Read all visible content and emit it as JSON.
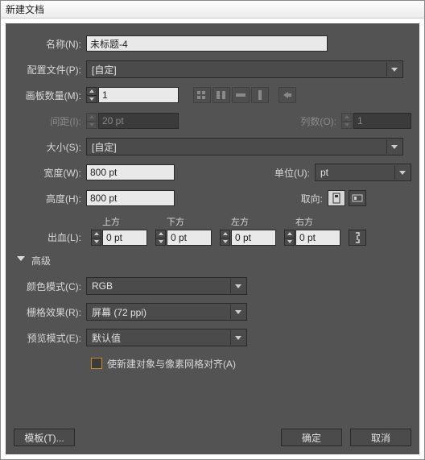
{
  "title": "新建文档",
  "name": {
    "label": "名称(N):",
    "value": "未标题-4"
  },
  "profile": {
    "label": "配置文件(P):",
    "value": "[自定]"
  },
  "artboards": {
    "label": "画板数量(M):",
    "value": "1"
  },
  "spacing": {
    "label": "间距(I):",
    "value": "20 pt"
  },
  "columns": {
    "label": "列数(O):",
    "value": "1"
  },
  "size": {
    "label": "大小(S):",
    "value": "[自定]"
  },
  "width": {
    "label": "宽度(W):",
    "value": "800 pt"
  },
  "units": {
    "label": "单位(U):",
    "value": "pt"
  },
  "height": {
    "label": "高度(H):",
    "value": "800 pt"
  },
  "orientation": {
    "label": "取向:"
  },
  "bleed": {
    "label": "出血(L):",
    "top": {
      "hdr": "上方",
      "value": "0 pt"
    },
    "bottom": {
      "hdr": "下方",
      "value": "0 pt"
    },
    "left": {
      "hdr": "左方",
      "value": "0 pt"
    },
    "right": {
      "hdr": "右方",
      "value": "0 pt"
    }
  },
  "advanced": {
    "label": "高级"
  },
  "colormode": {
    "label": "颜色模式(C):",
    "value": "RGB"
  },
  "raster": {
    "label": "栅格效果(R):",
    "value": "屏幕 (72 ppi)"
  },
  "preview": {
    "label": "预览模式(E):",
    "value": "默认值"
  },
  "align": {
    "label": "使新建对象与像素网格对齐(A)"
  },
  "buttons": {
    "template": "模板(T)...",
    "ok": "确定",
    "cancel": "取消"
  }
}
